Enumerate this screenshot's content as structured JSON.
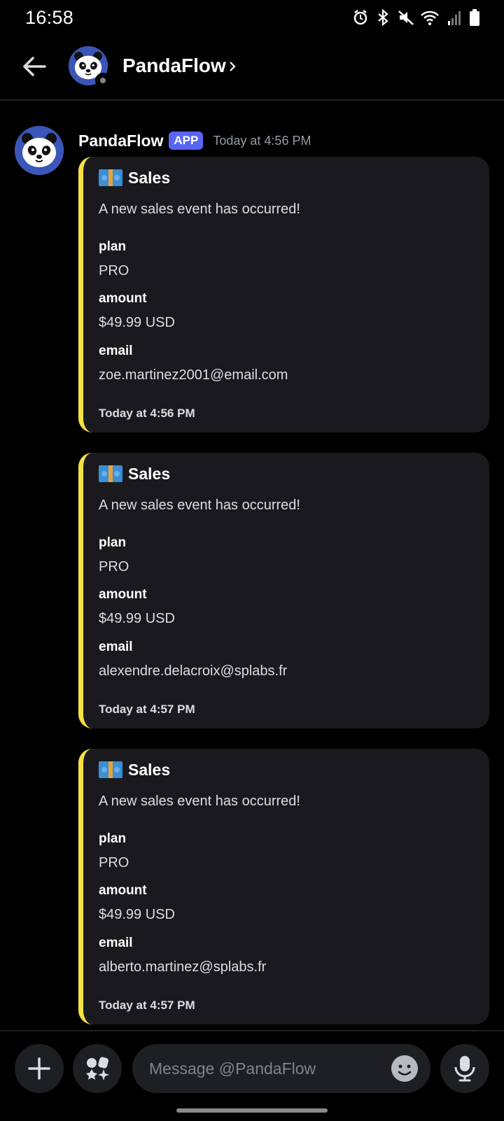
{
  "status_bar": {
    "time": "16:58",
    "icons": [
      "alarm-icon",
      "bluetooth-icon",
      "mute-icon",
      "wifi-icon",
      "signal-icon",
      "battery-icon"
    ]
  },
  "header": {
    "title": "PandaFlow",
    "chevron": "›"
  },
  "message": {
    "author": "PandaFlow",
    "app_tag": "APP",
    "timestamp": "Today at 4:56 PM",
    "embeds": [
      {
        "title": "Sales",
        "description": "A new sales event has occurred!",
        "fields": [
          {
            "name": "plan",
            "value": "PRO"
          },
          {
            "name": "amount",
            "value": "$49.99 USD"
          },
          {
            "name": "email",
            "value": "zoe.martinez2001@email.com"
          }
        ],
        "footer": "Today at 4:56 PM"
      },
      {
        "title": "Sales",
        "description": "A new sales event has occurred!",
        "fields": [
          {
            "name": "plan",
            "value": "PRO"
          },
          {
            "name": "amount",
            "value": "$49.99 USD"
          },
          {
            "name": "email",
            "value": "alexendre.delacroix@splabs.fr"
          }
        ],
        "footer": "Today at 4:57 PM"
      },
      {
        "title": "Sales",
        "description": "A new sales event has occurred!",
        "fields": [
          {
            "name": "plan",
            "value": "PRO"
          },
          {
            "name": "amount",
            "value": "$49.99 USD"
          },
          {
            "name": "email",
            "value": "alberto.martinez@splabs.fr"
          }
        ],
        "footer": "Today at 4:57 PM"
      }
    ]
  },
  "composer": {
    "placeholder": "Message @PandaFlow"
  },
  "colors": {
    "background": "#000000",
    "embed_bg": "#1a1a1e",
    "embed_accent": "#f5e042",
    "app_tag": "#5865f2",
    "avatar_bg": "#3b56b8"
  }
}
